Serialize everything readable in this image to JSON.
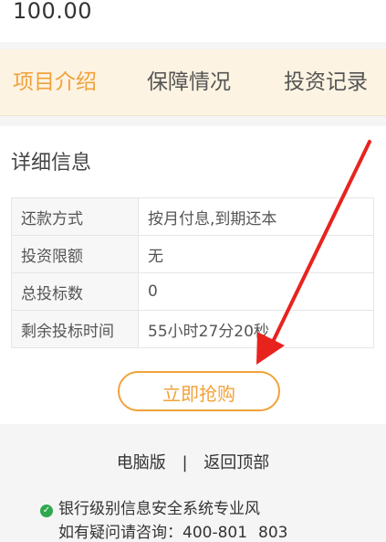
{
  "amount": "100.00",
  "tabs": [
    {
      "label": "项目介绍",
      "active": true
    },
    {
      "label": "保障情况",
      "active": false
    },
    {
      "label": "投资记录",
      "active": false
    }
  ],
  "details": {
    "title": "详细信息",
    "rows": [
      {
        "label": "还款方式",
        "value": "按月付息,到期还本"
      },
      {
        "label": "投资限额",
        "value": "无"
      },
      {
        "label": "总投标数",
        "value": "0"
      },
      {
        "label": "剩余投标时间",
        "value": "55小时27分20秒"
      }
    ]
  },
  "buy_button": "立即抢购",
  "footer": {
    "desktop_link": "电脑版",
    "separator": "|",
    "top_link": "返回顶部",
    "security_text": "银行级别信息安全系统专业风",
    "hotline": "如有疑问请咨询：400-801",
    "hotline_tail": "803"
  },
  "colors": {
    "accent": "#f0a23a",
    "tab_bar_bg": "#fdf3e2",
    "annotation_arrow": "#e8231e",
    "shield": "#2fa84f"
  }
}
